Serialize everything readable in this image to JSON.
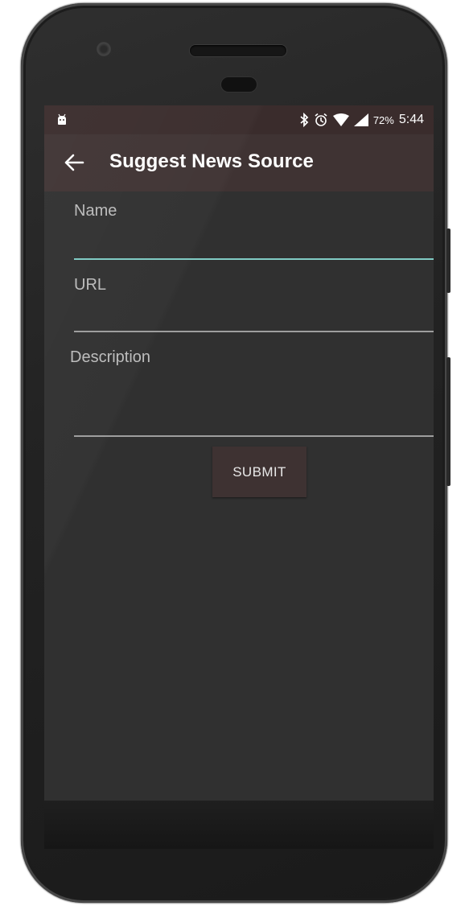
{
  "status_bar": {
    "battery_percent": "72%",
    "time": "5:44",
    "icons": [
      "android-icon",
      "bluetooth-icon",
      "alarm-icon",
      "wifi-icon",
      "signal-icon"
    ]
  },
  "toolbar": {
    "title": "Suggest News Source",
    "back_icon": "arrow-back-icon"
  },
  "form": {
    "name_label": "Name",
    "name_value": "",
    "url_label": "URL",
    "url_value": "",
    "description_label": "Description",
    "description_value": "",
    "submit_label": "SUBMIT"
  },
  "colors": {
    "status_bar": "#3a2c2c",
    "toolbar": "#3f3333",
    "background": "#303030",
    "accent": "#80cbc4",
    "button": "#3e3232"
  }
}
